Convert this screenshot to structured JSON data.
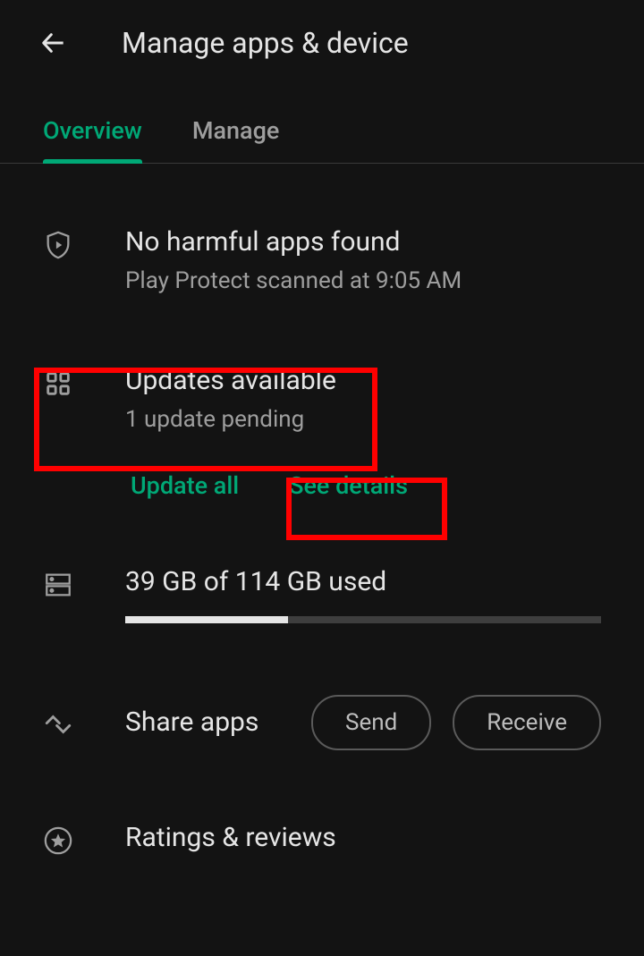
{
  "header": {
    "title": "Manage apps & device"
  },
  "tabs": {
    "overview": "Overview",
    "manage": "Manage"
  },
  "protect": {
    "title": "No harmful apps found",
    "subtitle": "Play Protect scanned at 9:05 AM"
  },
  "updates": {
    "title": "Updates available",
    "subtitle": "1 update pending",
    "update_all": "Update all",
    "see_details": "See details"
  },
  "storage": {
    "title": "39 GB of 114 GB used",
    "used_gb": 39,
    "total_gb": 114,
    "fill_percent": 34.2
  },
  "share": {
    "title": "Share apps",
    "send": "Send",
    "receive": "Receive"
  },
  "ratings": {
    "title": "Ratings & reviews"
  }
}
